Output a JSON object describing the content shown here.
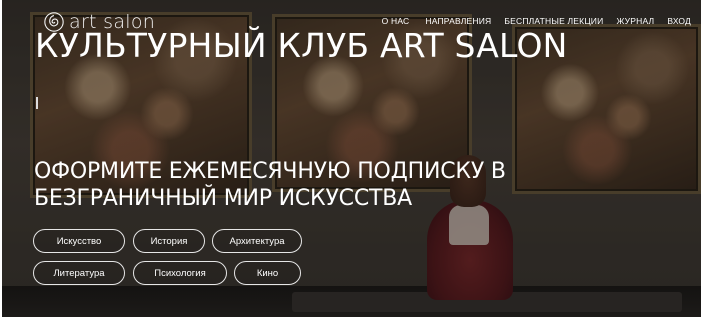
{
  "logo": {
    "text": "art salon",
    "icon": "spiral-logo-icon"
  },
  "nav": {
    "items": [
      "О НАС",
      "НАПРАВЛЕНИЯ",
      "БЕСПЛАТНЫЕ ЛЕКЦИИ",
      "ЖУРНАЛ",
      "ВХОД"
    ]
  },
  "hero": {
    "title": "КУЛЬТУРНЫЙ КЛУБ ART SALON",
    "subtitle_line1": "ОФОРМИТЕ ЕЖЕМЕСЯЧНУЮ ПОДПИСКУ В",
    "subtitle_line2": "БЕЗГРАНИЧНЫЙ МИР ИСКУССТВА"
  },
  "categories": [
    "Искусство",
    "История",
    "Архитектура",
    "Литература",
    "Психология",
    "Кино"
  ],
  "colors": {
    "text": "#ffffff",
    "pill_border": "#e6e6e6",
    "overlay": "#000000"
  }
}
